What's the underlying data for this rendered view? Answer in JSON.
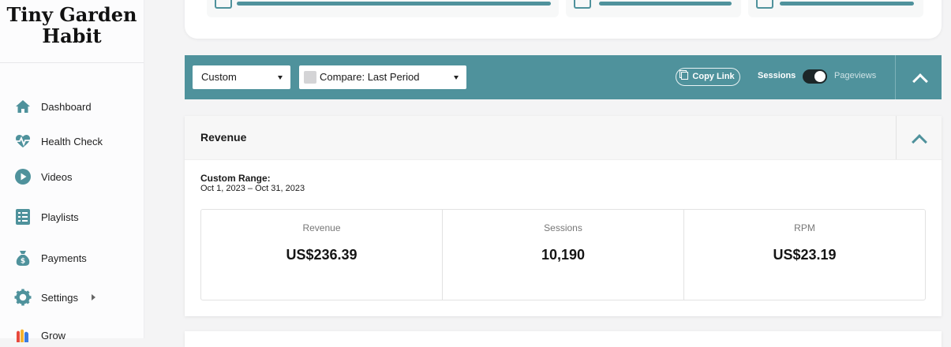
{
  "brand": {
    "line1": "Tiny Garden",
    "line2": "Habit"
  },
  "sidebar": {
    "items": [
      {
        "label": "Dashboard",
        "icon": "home-icon"
      },
      {
        "label": "Health Check",
        "icon": "heartbeat-icon"
      },
      {
        "label": "Videos",
        "icon": "play-icon"
      },
      {
        "label": "Playlists",
        "icon": "list-icon"
      },
      {
        "label": "Payments",
        "icon": "money-bag-icon"
      },
      {
        "label": "Settings",
        "icon": "gear-icon"
      },
      {
        "label": "Grow",
        "icon": "grow-logo-icon"
      }
    ]
  },
  "toolbar": {
    "range_select": "Custom",
    "compare_select": "Compare: Last Period",
    "copy_link": "Copy Link",
    "toggle_left": "Sessions",
    "toggle_right": "Pageviews"
  },
  "revenue": {
    "title": "Revenue",
    "range_label": "Custom Range:",
    "range_value": "Oct 1, 2023 – Oct 31, 2023",
    "metrics": [
      {
        "label": "Revenue",
        "value": "US$236.39"
      },
      {
        "label": "Sessions",
        "value": "10,190"
      },
      {
        "label": "RPM",
        "value": "US$23.19"
      }
    ]
  },
  "colors": {
    "accent": "#4f929c",
    "icon": "#4f929c"
  }
}
